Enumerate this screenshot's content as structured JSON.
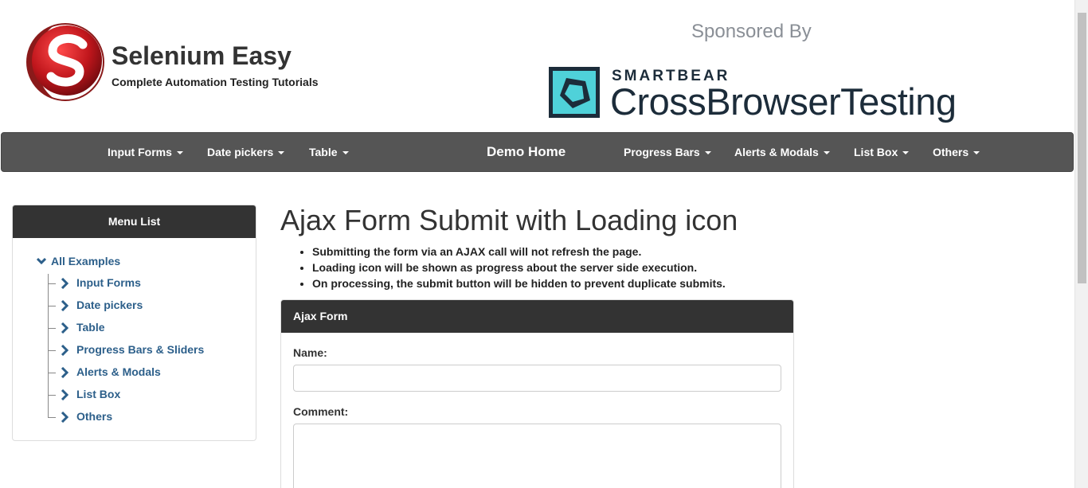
{
  "header": {
    "brand_title": "Selenium Easy",
    "brand_subtitle": "Complete Automation Testing Tutorials",
    "sponsored_label": "Sponsored By",
    "sponsor_company": "SMARTBEAR",
    "sponsor_product": "CrossBrowserTesting"
  },
  "navbar": {
    "items_left": [
      "Input Forms",
      "Date pickers",
      "Table"
    ],
    "home": "Demo Home",
    "items_right": [
      "Progress Bars",
      "Alerts & Modals",
      "List Box",
      "Others"
    ]
  },
  "sidebar": {
    "title": "Menu List",
    "root": "All Examples",
    "items": [
      "Input Forms",
      "Date pickers",
      "Table",
      "Progress Bars & Sliders",
      "Alerts & Modals",
      "List Box",
      "Others"
    ]
  },
  "main": {
    "title": "Ajax Form Submit with Loading icon",
    "bullets": [
      "Submitting the form via an AJAX call will not refresh the page.",
      "Loading icon will be shown as progress about the server side execution.",
      "On processing, the submit button will be hidden to prevent duplicate submits."
    ],
    "form": {
      "title": "Ajax Form",
      "name_label": "Name:",
      "name_value": "",
      "comment_label": "Comment:",
      "comment_value": ""
    }
  },
  "colors": {
    "navbar_bg": "#555555",
    "panel_header_bg": "#333333",
    "link": "#2c5f8a",
    "logo_red": "#c0161c",
    "sponsor_teal": "#4fd1d9",
    "sponsor_dark": "#1c2c3a"
  }
}
